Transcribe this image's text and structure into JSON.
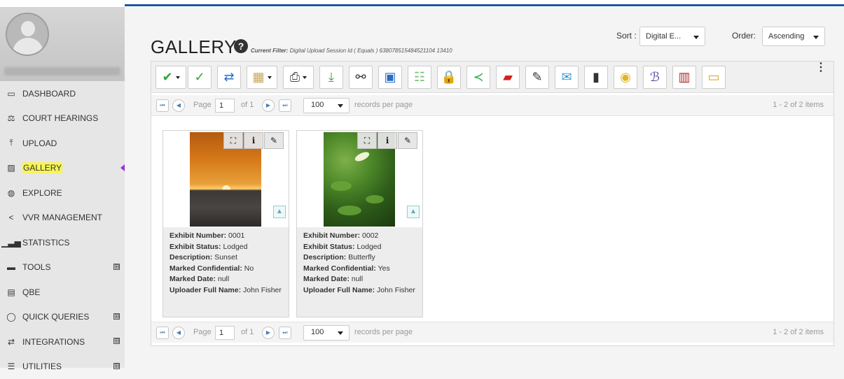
{
  "sidebar": {
    "items": [
      {
        "label": "DASHBOARD",
        "icon": "dashboard-icon",
        "glyph": "▭"
      },
      {
        "label": "COURT HEARINGS",
        "icon": "scales-icon",
        "glyph": "⚖"
      },
      {
        "label": "UPLOAD",
        "icon": "upload-icon",
        "glyph": "⤒"
      },
      {
        "label": "GALLERY",
        "icon": "gallery-icon",
        "glyph": "▨",
        "active": true
      },
      {
        "label": "EXPLORE",
        "icon": "globe-icon",
        "glyph": "◍"
      },
      {
        "label": "VVR MANAGEMENT",
        "icon": "share-icon",
        "glyph": "<"
      },
      {
        "label": "STATISTICS",
        "icon": "bar-chart-icon",
        "glyph": "▁▃▅"
      },
      {
        "label": "TOOLS",
        "icon": "toolbox-icon",
        "glyph": "▬",
        "expandable": true
      },
      {
        "label": "QBE",
        "icon": "form-icon",
        "glyph": "▤"
      },
      {
        "label": "QUICK QUERIES",
        "icon": "speech-bubble-icon",
        "glyph": "◯",
        "expandable": true
      },
      {
        "label": "INTEGRATIONS",
        "icon": "exchange-icon",
        "glyph": "⇄",
        "expandable": true
      },
      {
        "label": "UTILITIES",
        "icon": "sliders-icon",
        "glyph": "☰",
        "expandable": true
      }
    ],
    "expand_glyph": "⊞"
  },
  "header": {
    "title": "GALLERY",
    "help_glyph": "?",
    "filter_label": "Current Filter:",
    "filter_text": "Digital Upload Session Id ( Equals ) 638078515484521104  13410",
    "sort_label": "Sort :",
    "sort_value": "Digital E...",
    "order_label": "Order:",
    "order_value": "Ascending"
  },
  "toolbar": {
    "buttons": [
      {
        "icon": "check-bold-icon",
        "glyph": "✔",
        "color": "#3aa33a",
        "dropdown": true
      },
      {
        "icon": "check-outline-icon",
        "glyph": "✓",
        "color": "#3aa33a"
      },
      {
        "icon": "refresh-icon",
        "glyph": "⇄",
        "color": "#2a6cc7"
      },
      {
        "icon": "clipboard-icon",
        "glyph": "▦",
        "color": "#c9a75a",
        "dropdown": true
      },
      {
        "icon": "printer-icon",
        "glyph": "⎙",
        "color": "#444",
        "dropdown": true
      },
      {
        "icon": "download-icon",
        "glyph": "⤓",
        "color": "#3aa33a"
      },
      {
        "icon": "binoculars-icon",
        "glyph": "⚯",
        "color": "#333"
      },
      {
        "icon": "preview-icon",
        "glyph": "▣",
        "color": "#2a6cc7"
      },
      {
        "icon": "list-icon",
        "glyph": "☷",
        "color": "#7cc07c"
      },
      {
        "icon": "lock-icon",
        "glyph": "🔒",
        "color": "#d8a21a"
      },
      {
        "icon": "share-icon",
        "glyph": "≺",
        "color": "#2eaa4a"
      },
      {
        "icon": "pdf-icon",
        "glyph": "▰",
        "color": "#d2231e"
      },
      {
        "icon": "sign-icon",
        "glyph": "✎",
        "color": "#333"
      },
      {
        "icon": "email-icon",
        "glyph": "✉",
        "color": "#2a9ad6"
      },
      {
        "icon": "trash-icon",
        "glyph": "▮",
        "color": "#333"
      },
      {
        "icon": "disc-icon",
        "glyph": "◉",
        "color": "#e3b22a"
      },
      {
        "icon": "signature-icon",
        "glyph": "ℬ",
        "color": "#5a4aa0"
      },
      {
        "icon": "barcode-icon",
        "glyph": "▥",
        "color": "#b02a2a"
      },
      {
        "icon": "card-icon",
        "glyph": "▭",
        "color": "#e0a020"
      }
    ],
    "menu_glyph": "⋮"
  },
  "pager": {
    "first_glyph": "⏮",
    "prev_glyph": "◀",
    "next_glyph": "▶",
    "last_glyph": "⏭",
    "page_label": "Page",
    "page_value": "1",
    "of_label": "of 1",
    "per_page_value": "100",
    "per_page_label": "records per page",
    "items_text": "1 - 2 of 2 items"
  },
  "exhibits": [
    {
      "image": "sunset",
      "number_label": "Exhibit Number:",
      "number": "0001",
      "status_label": "Exhibit Status:",
      "status": "Lodged",
      "description_label": "Description:",
      "description": "Sunset",
      "confidential_label": "Marked Confidential:",
      "confidential": "No",
      "date_label": "Marked Date:",
      "date": "null",
      "uploader_label": "Uploader Full Name:",
      "uploader": "John Fisher"
    },
    {
      "image": "butterfly",
      "number_label": "Exhibit Number:",
      "number": "0002",
      "status_label": "Exhibit Status:",
      "status": "Lodged",
      "description_label": "Description:",
      "description": "Butterfly",
      "confidential_label": "Marked Confidential:",
      "confidential": "Yes",
      "date_label": "Marked Date:",
      "date": "null",
      "uploader_label": "Uploader Full Name:",
      "uploader": "John Fisher"
    }
  ],
  "card_actions": {
    "fullscreen_glyph": "⛶",
    "info_glyph": "i",
    "edit_glyph": "✎",
    "image_glyph": "▲"
  },
  "colors": {
    "accent_bar": "#1c5aa0",
    "active_highlight": "#f7f45a",
    "active_caret": "#9b30d9"
  }
}
